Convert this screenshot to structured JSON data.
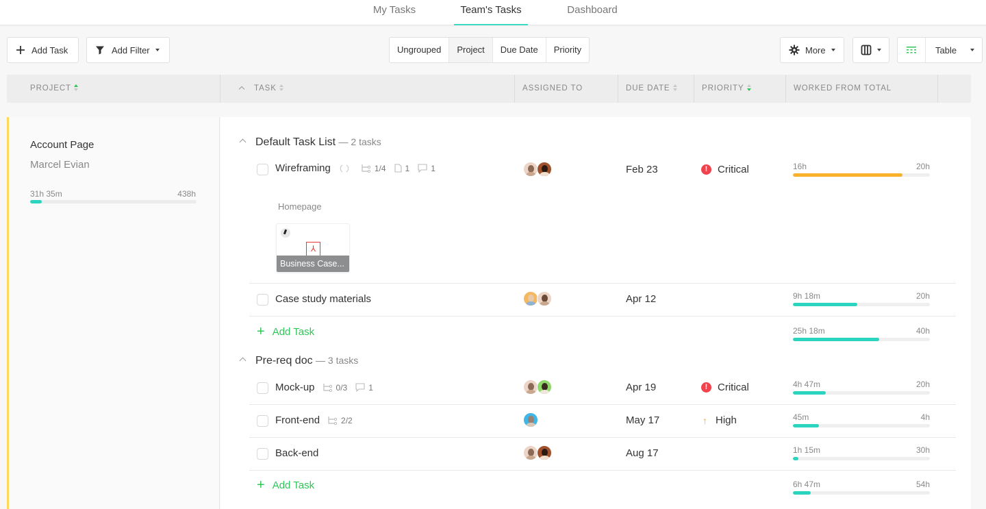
{
  "nav": {
    "tabs": [
      {
        "label": "My Tasks",
        "active": false
      },
      {
        "label": "Team's Tasks",
        "active": true
      },
      {
        "label": "Dashboard",
        "active": false
      }
    ]
  },
  "toolbar": {
    "add_task": "Add Task",
    "add_filter": "Add Filter",
    "grouping": [
      {
        "label": "Ungrouped",
        "active": false
      },
      {
        "label": "Project",
        "active": true
      },
      {
        "label": "Due Date",
        "active": false
      },
      {
        "label": "Priority",
        "active": false
      }
    ],
    "more": "More",
    "view": "Table"
  },
  "columns": {
    "project": "PROJECT",
    "task": "TASK",
    "assigned_to": "ASSIGNED TO",
    "due_date": "DUE DATE",
    "priority": "PRIORITY",
    "worked": "WORKED FROM TOTAL"
  },
  "project": {
    "name": "Account Page",
    "owner": "Marcel Evian",
    "worked": "31h 35m",
    "total": "438h",
    "progress_pct": 7
  },
  "groups": [
    {
      "title": "Default Task List",
      "count": "— 2 tasks",
      "tasks": [
        {
          "name": "Wireframing",
          "subtasks": "1/4",
          "files": "1",
          "comments": "1",
          "due": "Feb 23",
          "priority": "Critical",
          "worked": "16h",
          "total": "20h",
          "progress_pct": 80,
          "attachment_section": "Homepage",
          "attachment_name": "Business Case..."
        },
        {
          "name": "Case study materials",
          "due": "Apr 12",
          "priority": "",
          "worked": "9h 18m",
          "total": "20h",
          "progress_pct": 47
        }
      ],
      "add_task": "Add Task",
      "summary": {
        "worked": "25h 18m",
        "total": "40h",
        "progress_pct": 63
      }
    },
    {
      "title": "Pre-req doc",
      "count": "— 3 tasks",
      "tasks": [
        {
          "name": "Mock-up",
          "subtasks": "0/3",
          "comments": "1",
          "due": "Apr 19",
          "priority": "Critical",
          "worked": "4h 47m",
          "total": "20h",
          "progress_pct": 24
        },
        {
          "name": "Front-end",
          "subtasks": "2/2",
          "due": "May 17",
          "priority": "High",
          "worked": "45m",
          "total": "4h",
          "progress_pct": 19
        },
        {
          "name": "Back-end",
          "due": "Aug 17",
          "priority": "",
          "worked": "1h 15m",
          "total": "30h",
          "progress_pct": 4
        }
      ],
      "add_task": "Add Task",
      "summary": {
        "worked": "6h 47m",
        "total": "54h",
        "progress_pct": 13
      }
    }
  ],
  "colors": {
    "accent": "#2ad4bf",
    "warning_bar": "#fbb22b",
    "add_green": "#2ec757",
    "critical": "#f0434d",
    "high": "#f5a623",
    "project_stripe": "#ffd85a"
  }
}
